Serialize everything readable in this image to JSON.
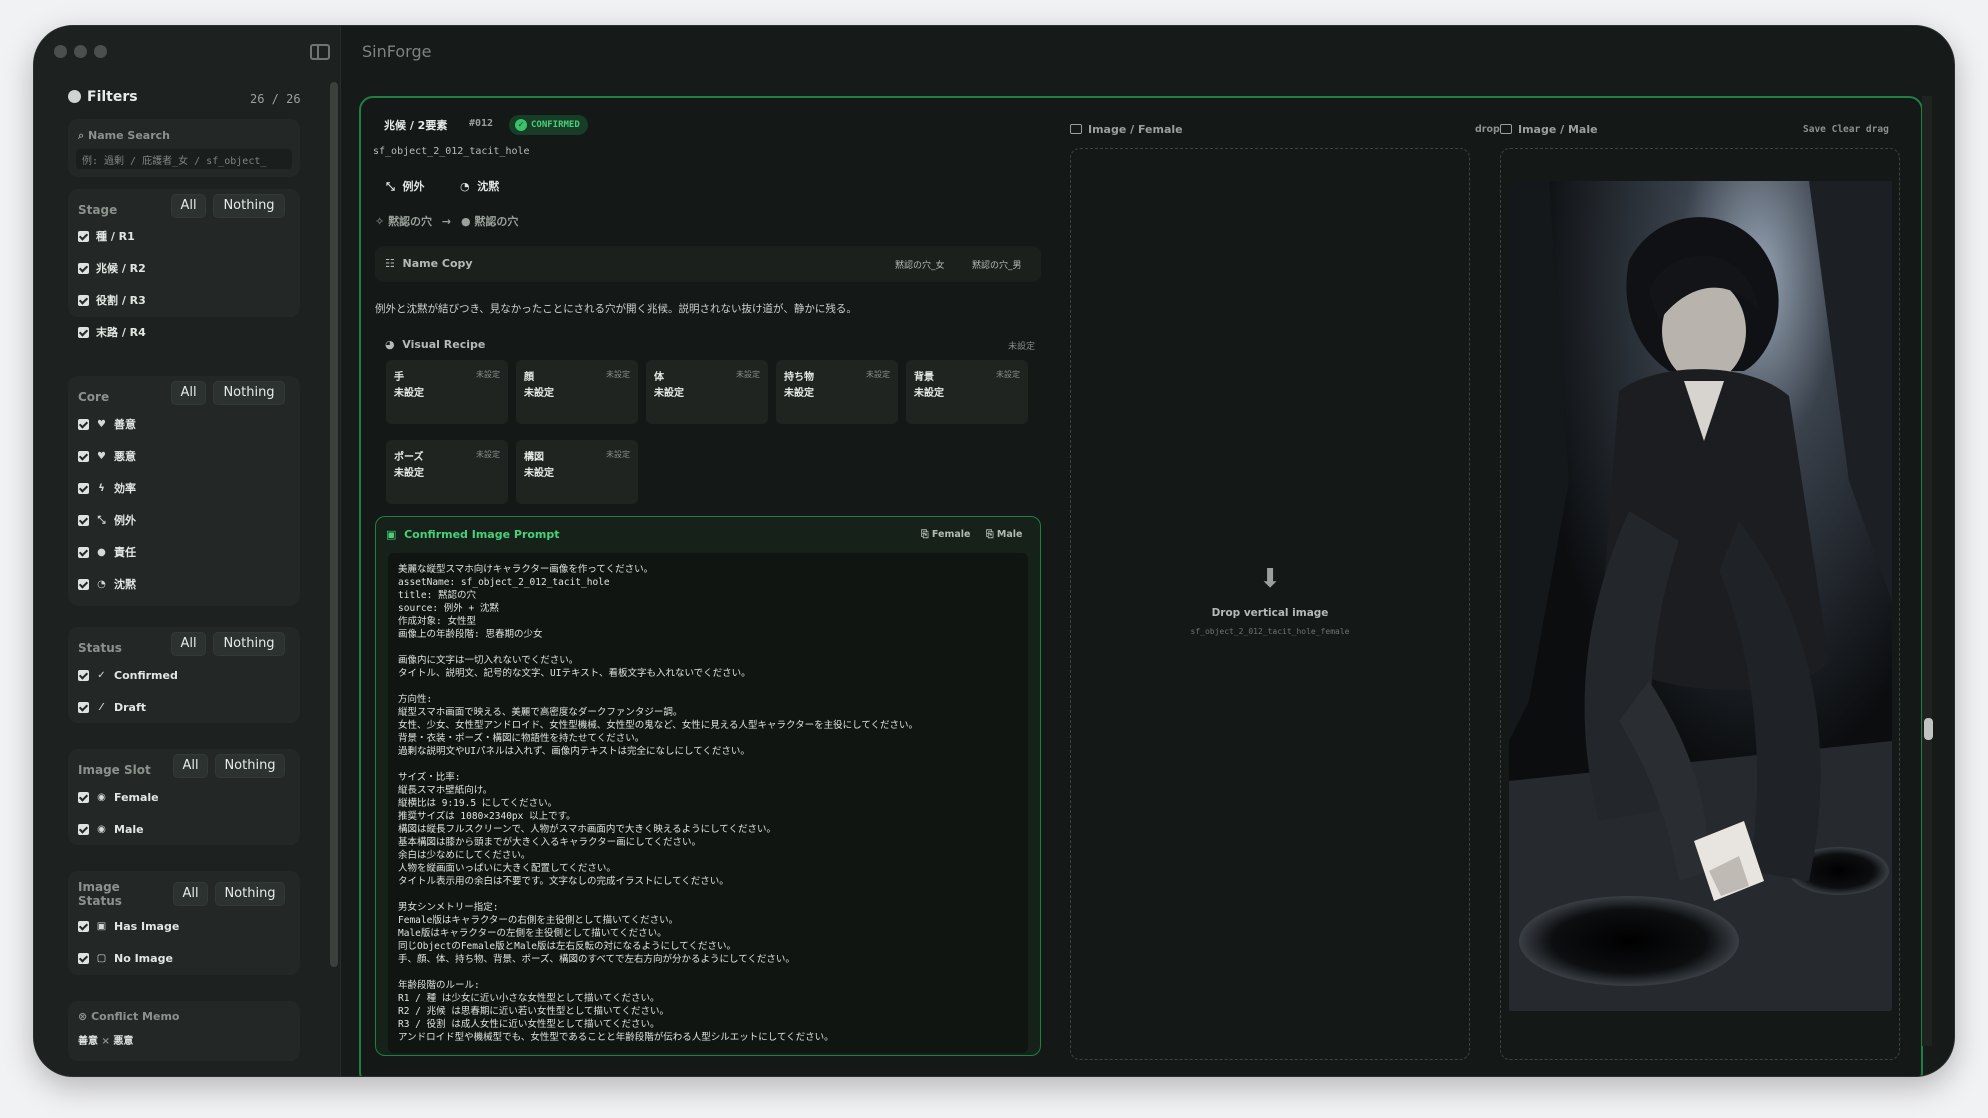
{
  "app": {
    "title": "SinForge"
  },
  "filters": {
    "title": "Filters",
    "count": "26 / 26",
    "search": {
      "label": "Name Search",
      "placeholder": "例: 過剰 / 庇護者_女 / sf_object_"
    },
    "all": "All",
    "nothing": "Nothing",
    "stage": {
      "label": "Stage",
      "items": [
        "種 / R1",
        "兆候 / R2",
        "役割 / R3",
        "末路 / R4"
      ]
    },
    "core": {
      "label": "Core",
      "items": [
        "善意",
        "悪意",
        "効率",
        "例外",
        "責任",
        "沈黙"
      ]
    },
    "status": {
      "label": "Status",
      "items": [
        "Confirmed",
        "Draft"
      ]
    },
    "image_slot": {
      "label": "Image Slot",
      "items": [
        "Female",
        "Male"
      ]
    },
    "image_status": {
      "label": "Image\nStatus",
      "label1": "Image",
      "label2": "Status",
      "items": [
        "Has Image",
        "No Image"
      ]
    },
    "conflict": {
      "title": "Conflict Memo",
      "a": "善意",
      "x": "×",
      "b": "悪意"
    }
  },
  "detail": {
    "breadcrumb": "兆候 / 2要素",
    "id": "#012",
    "status": "CONFIRMED",
    "asset": "sf_object_2_012_tacit_hole",
    "tags": [
      "例外",
      "沈黙"
    ],
    "from": "黙認の穴",
    "to": "黙認の穴",
    "namecopy": {
      "label": "Name Copy",
      "female": "黙認の穴_女",
      "male": "黙認の穴_男"
    },
    "description": "例外と沈黙が結びつき、見なかったことにされる穴が開く兆候。説明されない抜け道が、静かに残る。",
    "recipe": {
      "label": "Visual Recipe",
      "status": "未設定",
      "cells": [
        {
          "k": "手",
          "s": "未設定",
          "v": "未設定"
        },
        {
          "k": "顔",
          "s": "未設定",
          "v": "未設定"
        },
        {
          "k": "体",
          "s": "未設定",
          "v": "未設定"
        },
        {
          "k": "持ち物",
          "s": "未設定",
          "v": "未設定"
        },
        {
          "k": "背景",
          "s": "未設定",
          "v": "未設定"
        },
        {
          "k": "ポーズ",
          "s": "未設定",
          "v": "未設定"
        },
        {
          "k": "構図",
          "s": "未設定",
          "v": "未設定"
        }
      ]
    },
    "prompt": {
      "title": "Confirmed Image Prompt",
      "female": "Female",
      "male": "Male",
      "text": "美麗な縦型スマホ向けキャラクター画像を作ってください。\nassetName: sf_object_2_012_tacit_hole\ntitle: 黙認の穴\nsource: 例外 + 沈黙\n作成対象: 女性型\n画像上の年齢段階: 思春期の少女\n\n画像内に文字は一切入れないでください。\nタイトル、説明文、記号的な文字、UIテキスト、看板文字も入れないでください。\n\n方向性:\n縦型スマホ画面で映える、美麗で高密度なダークファンタジー調。\n女性、少女、女性型アンドロイド、女性型機械、女性型の鬼など、女性に見える人型キャラクターを主役にしてください。\n背景・衣装・ポーズ・構図に物語性を持たせてください。\n過剰な説明文やUIパネルは入れず、画像内テキストは完全になしにしてください。\n\nサイズ・比率:\n縦長スマホ壁紙向け。\n縦横比は 9:19.5 にしてください。\n推奨サイズは 1080×2340px 以上です。\n構図は縦長フルスクリーンで、人物がスマホ画面内で大きく映えるようにしてください。\n基本構図は膝から頭までが大きく入るキャラクター画にしてください。\n余白は少なめにしてください。\n人物を縦画面いっぱいに大きく配置してください。\nタイトル表示用の余白は不要です。文字なしの完成イラストにしてください。\n\n男女シンメトリー指定:\nFemale版はキャラクターの右側を主役側として描いてください。\nMale版はキャラクターの左側を主役側として描いてください。\n同じObjectのFemale版とMale版は左右反転の対になるようにしてください。\n手、顔、体、持ち物、背景、ポーズ、構図のすべてで左右方向が分かるようにしてください。\n\n年齢段階のルール:\nR1 / 種 は少女に近い小さな女性型として描いてください。\nR2 / 兆候 は思春期に近い若い女性型として描いてください。\nR3 / 役割 は成人女性に近い女性型として描いてください。\nアンドロイド型や機械型でも、女性型であることと年齢段階が伝わる人型シルエットにしてください。"
    }
  },
  "image_female": {
    "label": "Image / Female",
    "action": "drop",
    "drop_title": "Drop vertical image",
    "filename": "sf_object_2_012_tacit_hole_female"
  },
  "image_male": {
    "label": "Image / Male",
    "actions": "Save Clear drag"
  },
  "icons": [
    "filter-icon",
    "search-icon",
    "heart-icon",
    "lightning-icon",
    "comment-icon",
    "image-icon",
    "download-icon",
    "lock-icon",
    "copy-icon"
  ],
  "colors": {
    "accent": "#1f7f45",
    "confirmed": "#48d07a",
    "bg": "#141816"
  }
}
